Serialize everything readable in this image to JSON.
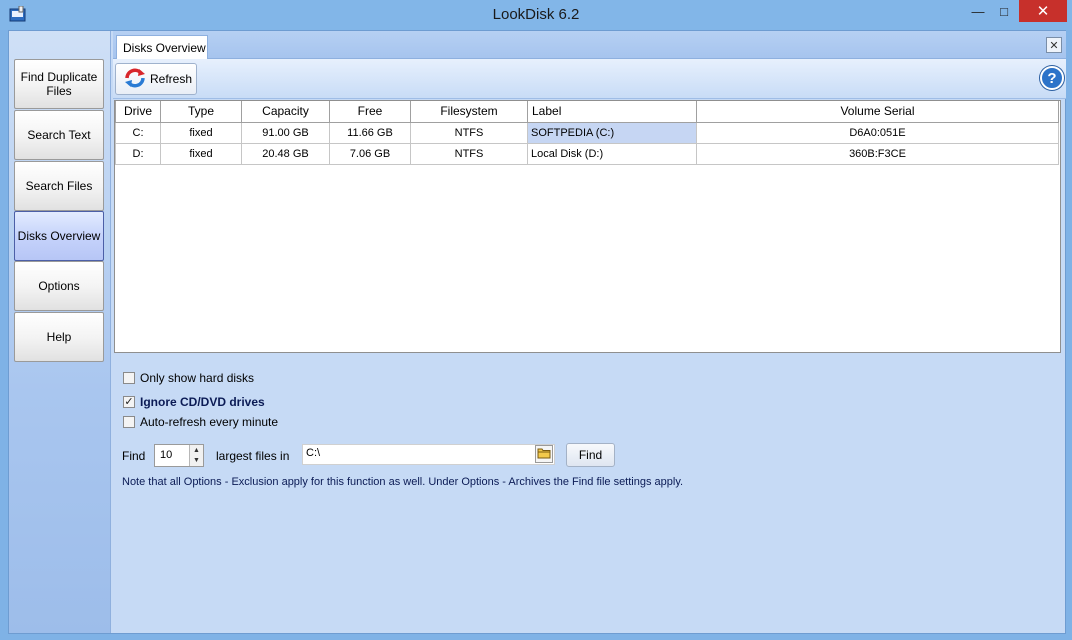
{
  "window": {
    "title": "LookDisk 6.2",
    "minimize_glyph": "—",
    "maximize_glyph": "□",
    "close_glyph": "✕"
  },
  "sidebar": {
    "items": [
      {
        "label": "Find Duplicate Files",
        "active": false
      },
      {
        "label": "Search Text",
        "active": false
      },
      {
        "label": "Search Files",
        "active": false
      },
      {
        "label": "Disks Overview",
        "active": true
      },
      {
        "label": "Options",
        "active": false
      },
      {
        "label": "Help",
        "active": false
      }
    ]
  },
  "tabs": {
    "active_label": "Disks Overview",
    "close_glyph": "✕"
  },
  "toolbar": {
    "refresh_label": "Refresh",
    "help_glyph": "?"
  },
  "table": {
    "columns": [
      "Drive",
      "Type",
      "Capacity",
      "Free",
      "Filesystem",
      "Label",
      "Volume Serial"
    ],
    "rows": [
      {
        "drive": "C:",
        "type": "fixed",
        "capacity": "91.00 GB",
        "free": "11.66 GB",
        "filesystem": "NTFS",
        "label": "SOFTPEDIA (C:)",
        "serial": "D6A0:051E"
      },
      {
        "drive": "D:",
        "type": "fixed",
        "capacity": "20.48 GB",
        "free": "7.06 GB",
        "filesystem": "NTFS",
        "label": "Local Disk (D:)",
        "serial": "360B:F3CE"
      }
    ]
  },
  "options": {
    "only_hard_disks": {
      "label": "Only show hard disks",
      "checked": false
    },
    "ignore_cd": {
      "label": "Ignore CD/DVD drives",
      "checked": true
    },
    "auto_refresh": {
      "label": "Auto-refresh every minute",
      "checked": false
    },
    "check_glyph": "✓"
  },
  "find": {
    "find_label": "Find",
    "count_value": "10",
    "largest_label": "largest files in",
    "path_value": "C:\\",
    "button_label": "Find",
    "spin_up": "▲",
    "spin_down": "▼"
  },
  "note": "Note that all Options - Exclusion apply for this function as well. Under Options  - Archives the Find file settings apply."
}
